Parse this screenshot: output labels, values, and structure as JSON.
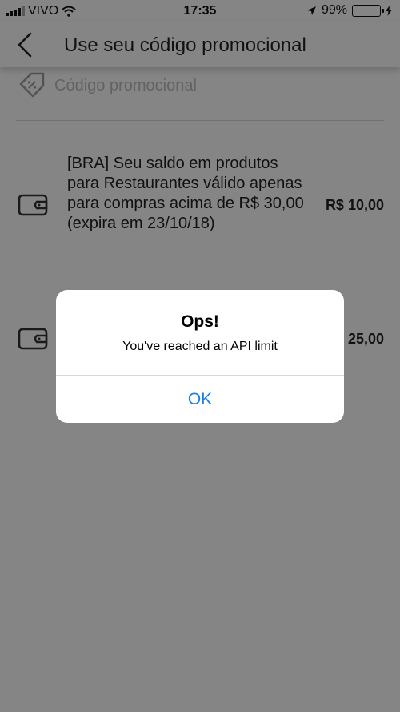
{
  "status_bar": {
    "carrier": "VIVO",
    "time": "17:35",
    "battery": "99%",
    "battery_level": 0.99
  },
  "header": {
    "title": "Use seu código promocional"
  },
  "promo": {
    "placeholder": "Código promocional"
  },
  "credits": [
    {
      "description": "[BRA] Seu saldo em produtos para Restaurantes válido apenas para compras acima de R$ 30,00 (expira em 23/10/18)",
      "amount": "R$ 10,00"
    },
    {
      "description": "",
      "amount": "25,00"
    }
  ],
  "dialog": {
    "title": "Ops!",
    "message": "You've reached an API limit",
    "button": "OK"
  },
  "colors": {
    "accent": "#1a7fe0",
    "battery": "#4cd964"
  }
}
